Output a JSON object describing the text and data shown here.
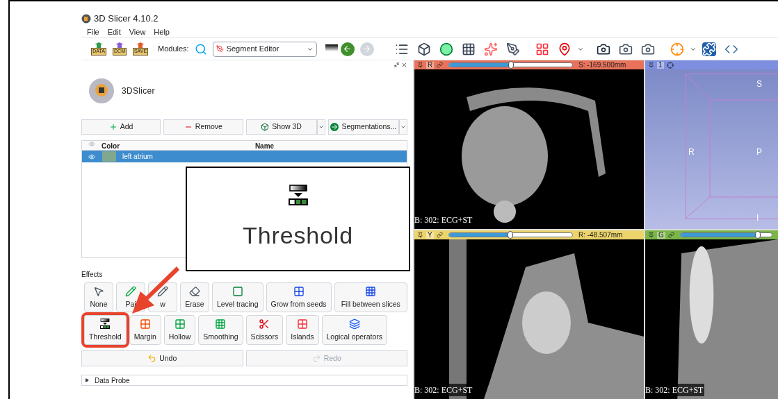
{
  "window": {
    "title": "3D Slicer 4.10.2"
  },
  "menu": [
    "File",
    "Edit",
    "View",
    "Help"
  ],
  "toolbar": {
    "file_buttons": [
      "DATA",
      "DCM",
      "SAVE"
    ],
    "modules_label": "Modules:",
    "module": "Segment Editor"
  },
  "logo": {
    "text": "3DSlicer"
  },
  "segment_buttons": [
    {
      "label": "Add",
      "dropdown": false
    },
    {
      "label": "Remove",
      "dropdown": false
    },
    {
      "label": "Show 3D",
      "dropdown": true
    },
    {
      "label": "Segmentations...",
      "dropdown": true
    }
  ],
  "table": {
    "columns": [
      "Color",
      "Name"
    ],
    "rows": [
      {
        "name": "left atrium",
        "color": "#7fa88f",
        "visible": true,
        "selected": true
      }
    ]
  },
  "callout": {
    "label": "Threshold"
  },
  "effects": {
    "title": "Effects",
    "rows": [
      {
        "items": [
          {
            "label": "None",
            "highlighted": false
          },
          {
            "label": "Pai",
            "highlighted": false
          },
          {
            "label": "w",
            "highlighted": false
          },
          {
            "label": "Erase",
            "highlighted": false
          },
          {
            "label": "Level tracing",
            "highlighted": false
          },
          {
            "label": "Grow from seeds",
            "highlighted": false
          },
          {
            "label": "Fill between slices",
            "highlighted": false
          }
        ]
      },
      {
        "items": [
          {
            "label": "Threshold",
            "highlighted": true
          },
          {
            "label": "Margin",
            "highlighted": false
          },
          {
            "label": "Hollow",
            "highlighted": false
          },
          {
            "label": "Smoothing",
            "highlighted": false
          },
          {
            "label": "Scissors",
            "highlighted": false
          },
          {
            "label": "Islands",
            "highlighted": false
          },
          {
            "label": "Logical operators",
            "highlighted": false
          }
        ]
      }
    ]
  },
  "history": [
    {
      "label": "Undo",
      "disabled": false
    },
    {
      "label": "Redo",
      "disabled": true
    }
  ],
  "data_probe": {
    "label": "Data Probe",
    "expanded": false
  },
  "views": [
    {
      "kind": "slice",
      "letter": "R",
      "color": "#e8735a",
      "offset": "S: -169.500mm",
      "level": 0.5,
      "overlay": "B: 302: ECG+ST"
    },
    {
      "kind": "volume",
      "letter": "1",
      "color": "#7f8fe0",
      "axes": [
        "S",
        "R",
        "P",
        "I"
      ]
    },
    {
      "kind": "slice",
      "letter": "Y",
      "color": "#ecd46a",
      "offset": "R: -48.507mm",
      "level": 0.5,
      "overlay": "B: 302: ECG+ST"
    },
    {
      "kind": "slice",
      "letter": "G",
      "color": "#7ab648",
      "level": 0.85,
      "overlay": "B: 302: ECG+ST"
    }
  ]
}
